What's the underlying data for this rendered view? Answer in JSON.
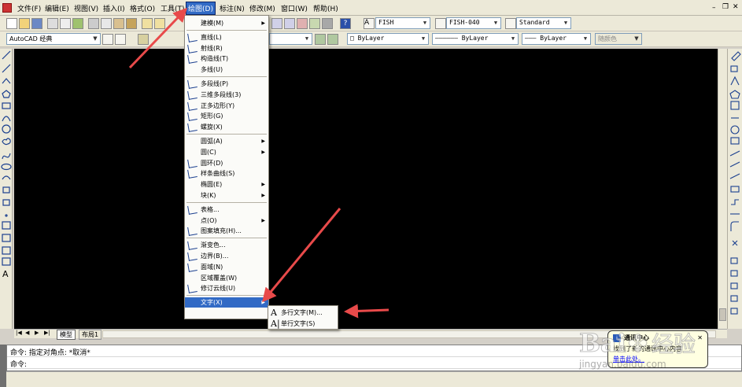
{
  "menubar": {
    "items": [
      "文件(F)",
      "编辑(E)",
      "视图(V)",
      "插入(I)",
      "格式(O)",
      "工具(T)",
      "绘图(D)",
      "标注(N)",
      "修改(M)",
      "窗口(W)",
      "帮助(H)"
    ],
    "active": "绘图(D)"
  },
  "toolbar": {
    "text_style": "FISH",
    "dim_style": "FISH-040",
    "table_style": "Standard",
    "workspace": "AutoCAD 经典",
    "color": "ByLayer",
    "linetype": "ByLayer",
    "lineweight": "ByLayer",
    "plotstyle": "随颜色"
  },
  "draw_menu": {
    "items": [
      {
        "label": "建模(M)",
        "submenu": true,
        "icon": "none"
      },
      {
        "label": "直线(L)",
        "icon": "line-icon"
      },
      {
        "label": "射线(R)",
        "icon": "ray-icon"
      },
      {
        "label": "构造线(T)",
        "icon": "xline-icon"
      },
      {
        "label": "多线(U)",
        "icon": "none"
      },
      {
        "label": "多段线(P)",
        "icon": "polyline-icon"
      },
      {
        "label": "三维多段线(3)",
        "icon": "3dpolyline-icon"
      },
      {
        "label": "正多边形(Y)",
        "icon": "polygon-icon"
      },
      {
        "label": "矩形(G)",
        "icon": "rectangle-icon"
      },
      {
        "label": "螺旋(X)",
        "icon": "helix-icon"
      },
      {
        "label": "圆弧(A)",
        "submenu": true,
        "icon": "none"
      },
      {
        "label": "圆(C)",
        "submenu": true,
        "icon": "none"
      },
      {
        "label": "圆环(D)",
        "icon": "donut-icon"
      },
      {
        "label": "样条曲线(S)",
        "icon": "spline-icon"
      },
      {
        "label": "椭圆(E)",
        "submenu": true,
        "icon": "none"
      },
      {
        "label": "块(K)",
        "submenu": true,
        "icon": "none"
      },
      {
        "label": "表格...",
        "icon": "table-icon"
      },
      {
        "label": "点(O)",
        "submenu": true,
        "icon": "none"
      },
      {
        "label": "图案填充(H)...",
        "icon": "hatch-icon"
      },
      {
        "label": "渐变色...",
        "icon": "gradient-icon"
      },
      {
        "label": "边界(B)...",
        "icon": "boundary-icon"
      },
      {
        "label": "面域(N)",
        "icon": "region-icon"
      },
      {
        "label": "区域覆盖(W)",
        "icon": "none"
      },
      {
        "label": "修订云线(U)",
        "icon": "revcloud-icon"
      },
      {
        "label": "文字(X)",
        "submenu": true,
        "icon": "none",
        "highlighted": true
      }
    ]
  },
  "text_submenu": {
    "items": [
      {
        "label": "多行文字(M)...",
        "icon": "A"
      },
      {
        "label": "单行文字(S)",
        "icon": "A|"
      }
    ]
  },
  "layout_tabs": [
    "模型",
    "布局1"
  ],
  "command_lines": [
    "命令: 指定对角点: *取消*",
    "命令:"
  ],
  "notification": {
    "title": "通讯中心",
    "body": "找到了新的通讯中心内容",
    "link": "单击此处。"
  },
  "colors": {
    "canvas": "#000000",
    "highlight": "#316ac5",
    "arrow": "#e84a4a"
  }
}
